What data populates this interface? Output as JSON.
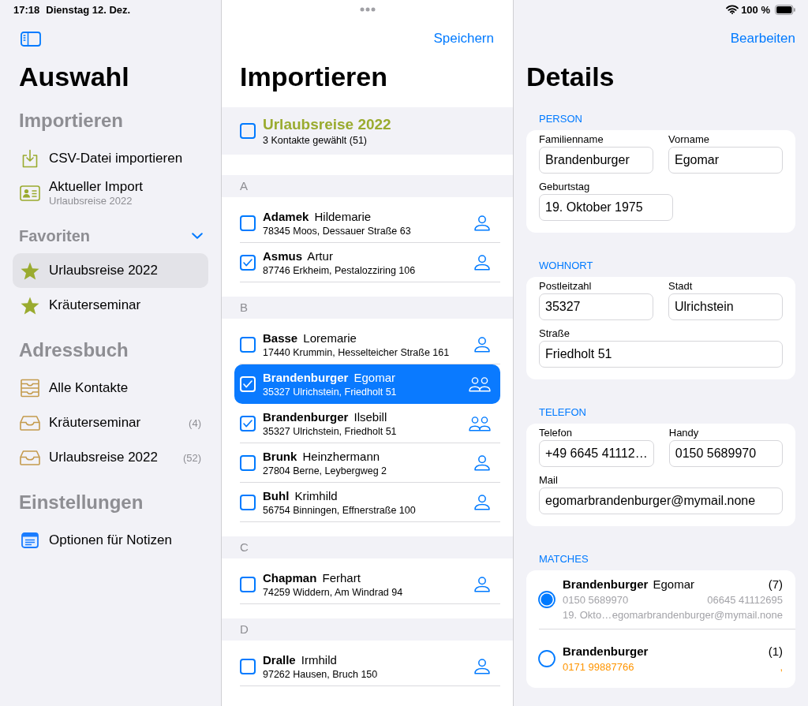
{
  "status_bar": {
    "time": "17:18",
    "date": "Dienstag 12. Dez.",
    "battery_text": "100 %"
  },
  "sidebar": {
    "title": "Auswahl",
    "sections": [
      {
        "title": "Importieren",
        "kind": "header",
        "items": [
          {
            "kind": "import",
            "label": "CSV-Datei importieren",
            "selected": false
          },
          {
            "kind": "current",
            "label": "Aktueller Import",
            "subtitle": "Urlaubsreise 2022",
            "selected": false
          }
        ]
      },
      {
        "title": "Favoriten",
        "kind": "collapsible",
        "expanded": true,
        "items": [
          {
            "kind": "favorite",
            "label": "Urlaubsreise 2022",
            "selected": true
          },
          {
            "kind": "favorite",
            "label": "Kräuterseminar",
            "selected": false
          }
        ]
      },
      {
        "title": "Adressbuch",
        "kind": "header",
        "items": [
          {
            "kind": "all",
            "label": "Alle Kontakte",
            "selected": false
          },
          {
            "kind": "group",
            "label": "Kräuterseminar",
            "count": "(4)",
            "selected": false
          },
          {
            "kind": "group",
            "label": "Urlaubsreise 2022",
            "count": "(52)",
            "selected": false
          }
        ]
      },
      {
        "title": "Einstellungen",
        "kind": "header",
        "items": [
          {
            "kind": "settings",
            "label": "Optionen für Notizen",
            "selected": false
          }
        ]
      }
    ]
  },
  "import": {
    "save_button": "Speichern",
    "title": "Importieren",
    "group": {
      "title": "Urlaubsreise 2022",
      "subtitle": "3 Kontakte gewählt (51)",
      "checked": false
    },
    "sections": [
      {
        "letter": "A",
        "rows": [
          {
            "surname": "Adamek",
            "first_name": "Hildemarie",
            "address": "78345 Moos, Dessauer Straße 63",
            "checked": false,
            "selected": false,
            "kind": "single"
          },
          {
            "surname": "Asmus",
            "first_name": "Artur",
            "address": "87746 Erkheim, Pestalozziring 106",
            "checked": true,
            "selected": false,
            "kind": "single"
          }
        ]
      },
      {
        "letter": "B",
        "rows": [
          {
            "surname": "Basse",
            "first_name": "Loremarie",
            "address": "17440 Krummin, Hesselteicher Straße 161",
            "checked": false,
            "selected": false,
            "kind": "single"
          },
          {
            "surname": "Brandenburger",
            "first_name": "Egomar",
            "address": "35327 Ulrichstein, Friedholt 51",
            "checked": true,
            "selected": true,
            "kind": "multiple"
          },
          {
            "surname": "Brandenburger",
            "first_name": "Ilsebill",
            "address": "35327 Ulrichstein, Friedholt 51",
            "checked": true,
            "selected": false,
            "kind": "multiple"
          },
          {
            "surname": "Brunk",
            "first_name": "Heinzhermann",
            "address": "27804 Berne, Leybergweg 2",
            "checked": false,
            "selected": false,
            "kind": "single"
          },
          {
            "surname": "Buhl",
            "first_name": "Krimhild",
            "address": "56754 Binningen, Effnerstraße 100",
            "checked": false,
            "selected": false,
            "kind": "single"
          }
        ]
      },
      {
        "letter": "C",
        "rows": [
          {
            "surname": "Chapman",
            "first_name": "Ferhart",
            "address": "74259 Widdern, Am Windrad 94",
            "checked": false,
            "selected": false,
            "kind": "single"
          }
        ]
      },
      {
        "letter": "D",
        "rows": [
          {
            "surname": "Dralle",
            "first_name": "Irmhild",
            "address": "97262 Hausen, Bruch 150",
            "checked": false,
            "selected": false,
            "kind": "single"
          }
        ]
      }
    ]
  },
  "details": {
    "edit_button": "Bearbeiten",
    "title": "Details",
    "sections": [
      {
        "title": "PERSON",
        "rows": [
          {
            "fields": [
              {
                "label": "Familienname",
                "value": "Brandenburger",
                "kind": "text"
              },
              {
                "label": "Vorname",
                "value": "Egomar",
                "kind": "text"
              }
            ]
          },
          {
            "fields": [
              {
                "label": "Geburtstag",
                "value": "19. Oktober 1975",
                "kind": "date"
              }
            ]
          }
        ]
      },
      {
        "title": "WOHNORT",
        "rows": [
          {
            "fields": [
              {
                "label": "Postleitzahl",
                "value": "35327",
                "kind": "text"
              },
              {
                "label": "Stadt",
                "value": "Ulrichstein",
                "kind": "text"
              }
            ]
          },
          {
            "fields": [
              {
                "label": "Straße",
                "value": "Friedholt 51",
                "kind": "text"
              }
            ]
          }
        ]
      },
      {
        "title": "TELEFON",
        "rows": [
          {
            "fields": [
              {
                "label": "Telefon",
                "value": "+49 6645 41112…",
                "kind": "text"
              },
              {
                "label": "Handy",
                "value": "0150 5689970",
                "kind": "text"
              }
            ]
          },
          {
            "fields": [
              {
                "label": "Mail",
                "value": "egomarbrandenburger@mymail.none",
                "kind": "text"
              }
            ]
          }
        ]
      }
    ],
    "matches": {
      "title": "MATCHES",
      "items": [
        {
          "surname": "Brandenburger",
          "first_name": "Egomar",
          "count": "(7)",
          "selected": true,
          "lines": [
            {
              "left": "0150 5689970",
              "right": "06645 41112695",
              "color": "#a3a3a8"
            },
            {
              "left": "19. Okto…",
              "right": "egomarbrandenburger@mymail.none",
              "color": "#a3a3a8"
            }
          ]
        },
        {
          "surname": "Brandenburger",
          "count": "(1)",
          "selected": false,
          "lines": [
            {
              "left": "0171 99887766",
              "right": ",",
              "color": "#ff9500"
            }
          ]
        }
      ]
    }
  }
}
